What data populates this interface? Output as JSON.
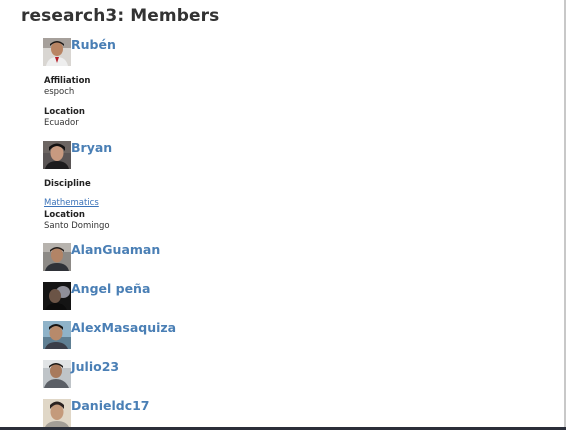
{
  "page": {
    "title": "research3: Members"
  },
  "members": [
    {
      "name": "Rubén",
      "avatar_icon": "user-avatar-photo",
      "fields": [
        {
          "label": "Affiliation",
          "value": "espoch"
        },
        {
          "label": "Location",
          "value": "Ecuador"
        }
      ]
    },
    {
      "name": "Bryan",
      "avatar_icon": "user-avatar-photo",
      "fields": [
        {
          "label": "Discipline",
          "value": "Mathematics"
        },
        {
          "label": "Location",
          "value": "Santo Domingo"
        }
      ]
    },
    {
      "name": "AlanGuaman",
      "avatar_icon": "user-avatar-photo"
    },
    {
      "name": "Angel peña",
      "avatar_icon": "user-avatar-photo"
    },
    {
      "name": "AlexMasaquiza",
      "avatar_icon": "user-avatar-photo"
    },
    {
      "name": "Julio23",
      "avatar_icon": "user-avatar-photo"
    },
    {
      "name": "Danieldc17",
      "avatar_icon": "user-avatar-photo"
    }
  ],
  "colors": {
    "name_link": "#4a7fb5",
    "value_link": "#3b73b9",
    "title": "#333333"
  }
}
